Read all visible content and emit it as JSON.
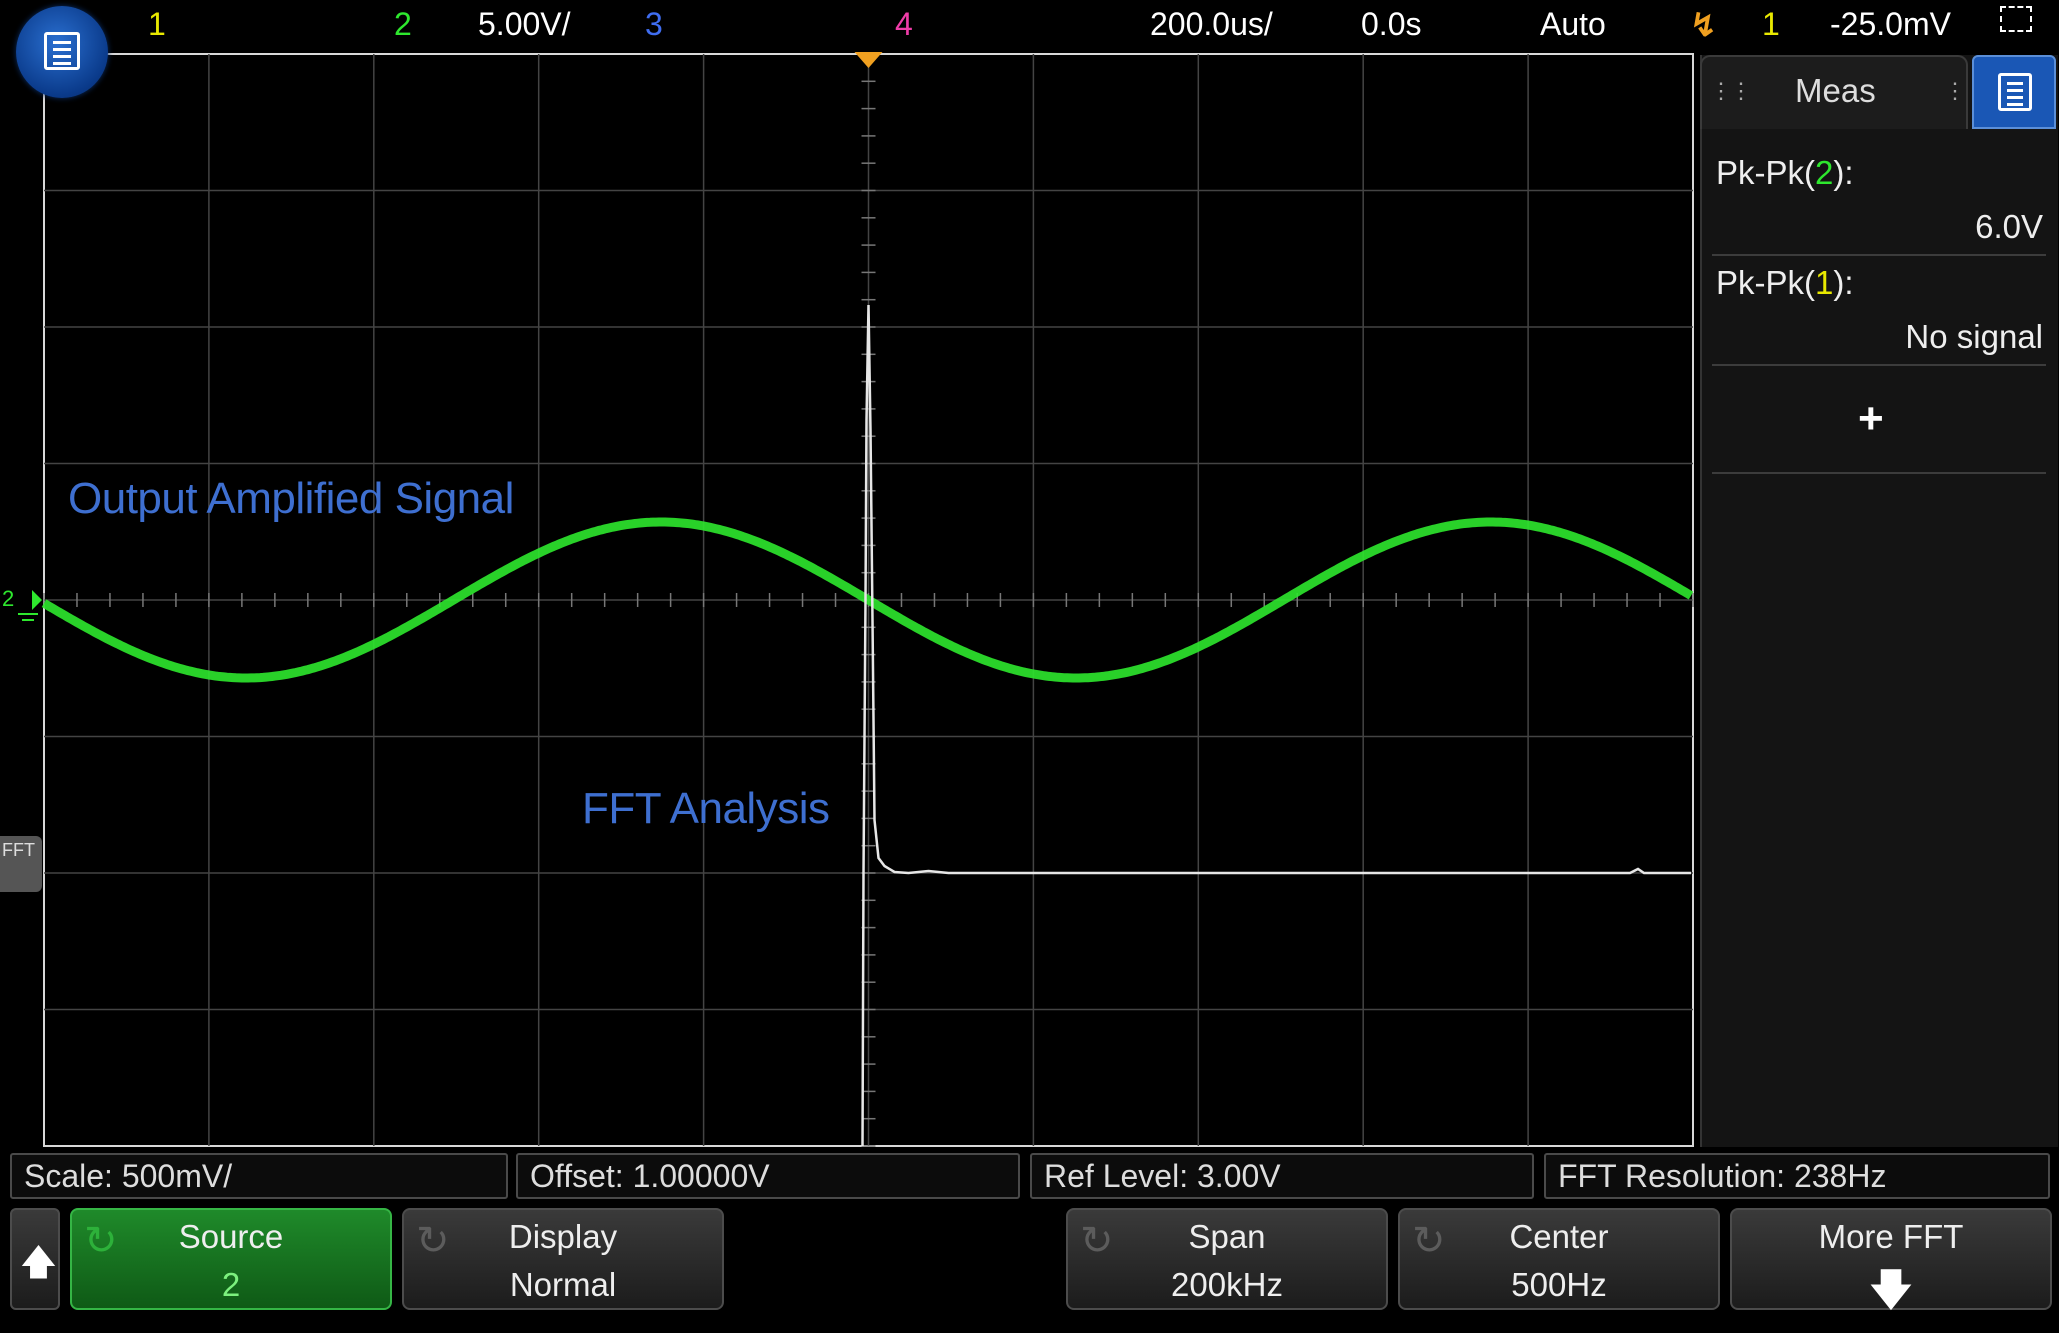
{
  "top_bar": {
    "ch1": "1",
    "ch2": "2",
    "ch2_scale": "5.00V/",
    "ch3": "3",
    "ch4": "4",
    "timebase": "200.0us/",
    "delay": "0.0s",
    "trigger_mode": "Auto",
    "trigger_icon": "trigger-edge-icon",
    "trigger_source": "1",
    "trigger_level": "-25.0mV",
    "zoom_icon": "zoom-select-icon"
  },
  "colors": {
    "ch1": "#e8e800",
    "ch2": "#2ee82e",
    "ch3": "#3f6df0",
    "ch4": "#ef3ca8",
    "trigger": "#f0a020",
    "label": "#3e6fd0"
  },
  "screen": {
    "label_output": "Output Amplified Signal",
    "label_fft": "FFT Analysis",
    "ch2_marker": "2",
    "fft_marker": "FFT"
  },
  "meas_panel": {
    "tab_label": "Meas",
    "items": [
      {
        "label_prefix": "Pk-Pk(",
        "channel": "2",
        "label_suffix": "):",
        "value": "6.0V"
      },
      {
        "label_prefix": "Pk-Pk(",
        "channel": "1",
        "label_suffix": "):",
        "value": "No signal"
      }
    ],
    "add_label": "+"
  },
  "info_bar": {
    "scale": "Scale: 500mV/",
    "offset": "Offset: 1.00000V",
    "ref_level": "Ref Level: 3.00V",
    "fft_resolution": "FFT Resolution: 238Hz"
  },
  "softkeys": {
    "back_icon": "up-arrow-icon",
    "source": {
      "title": "Source",
      "value": "2"
    },
    "display": {
      "title": "Display",
      "value": "Normal"
    },
    "span": {
      "title": "Span",
      "value": "200kHz"
    },
    "center": {
      "title": "Center",
      "value": "500Hz"
    },
    "more": {
      "title": "More FFT"
    }
  }
}
